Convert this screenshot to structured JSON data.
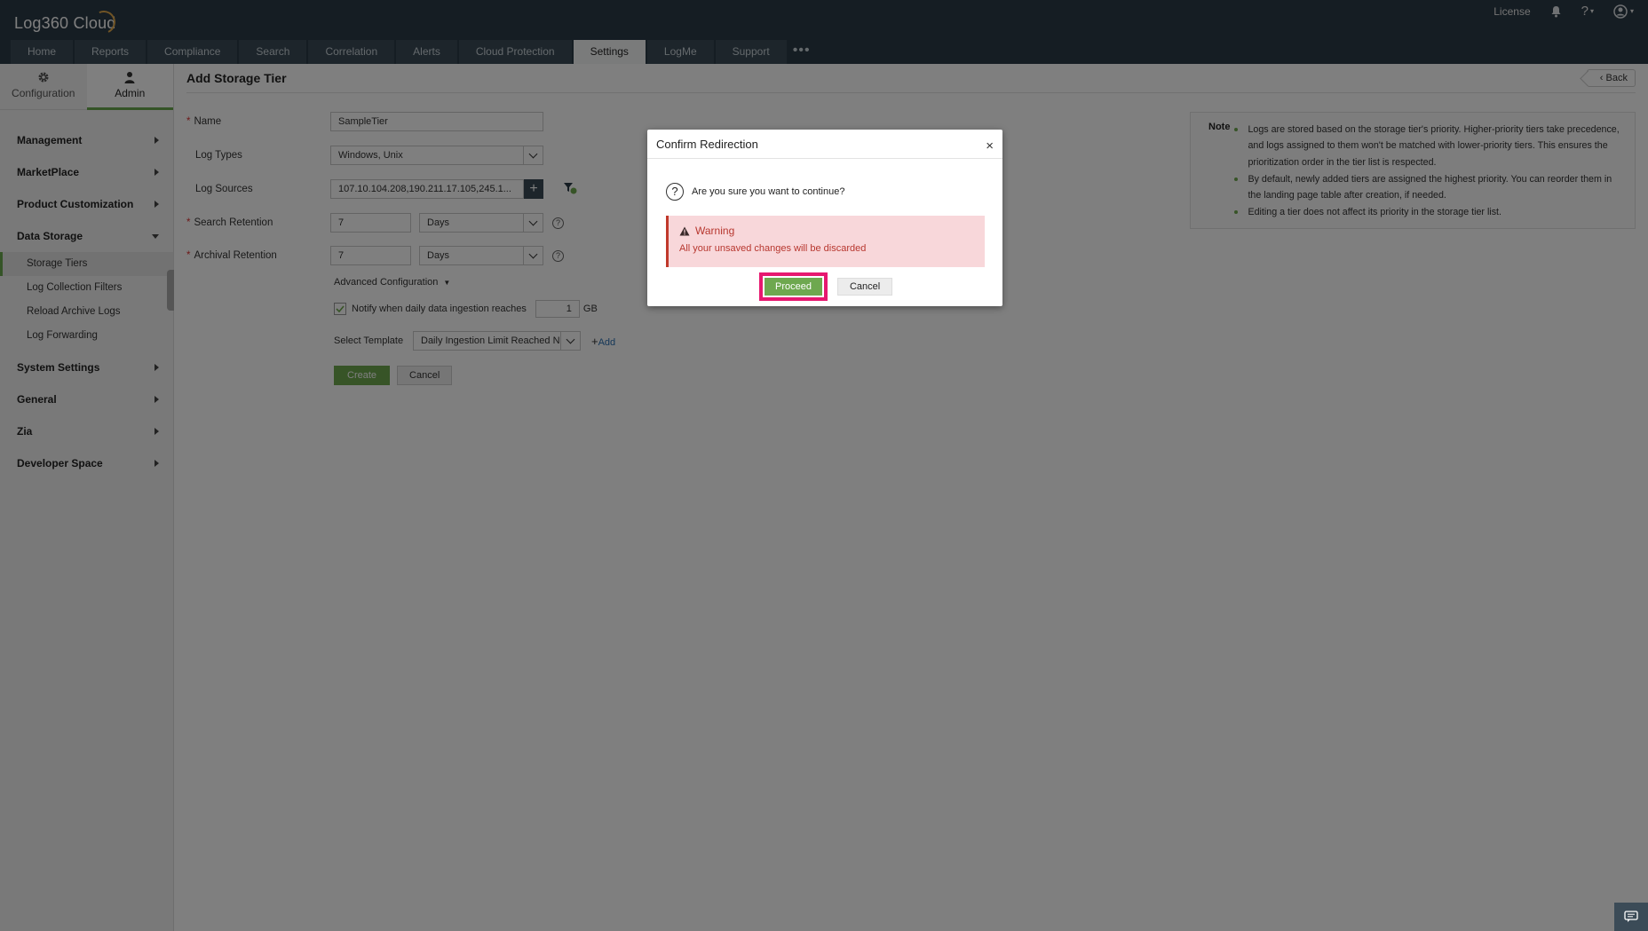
{
  "app": {
    "logo": "Log360 Cloud"
  },
  "header": {
    "license": "License",
    "tabs": [
      "Home",
      "Reports",
      "Compliance",
      "Search",
      "Correlation",
      "Alerts",
      "Cloud Protection",
      "Settings",
      "LogMe",
      "Support"
    ],
    "active_tab": "Settings",
    "more": "•••"
  },
  "sidebar": {
    "tabs": [
      {
        "label": "Configuration",
        "icon": "gear-icon"
      },
      {
        "label": "Admin",
        "icon": "user-icon"
      }
    ],
    "groups": [
      {
        "label": "Management"
      },
      {
        "label": "MarketPlace"
      },
      {
        "label": "Product Customization"
      },
      {
        "label": "Data Storage",
        "expanded": true,
        "items": [
          "Storage Tiers",
          "Log Collection Filters",
          "Reload Archive Logs",
          "Log Forwarding"
        ]
      },
      {
        "label": "System Settings"
      },
      {
        "label": "General"
      },
      {
        "label": "Zia"
      },
      {
        "label": "Developer Space"
      }
    ],
    "active_item": "Storage Tiers"
  },
  "main": {
    "title": "Add Storage Tier",
    "back": "Back",
    "form": {
      "name_label": "Name",
      "name_value": "SampleTier",
      "log_types_label": "Log Types",
      "log_types_value": "Windows, Unix",
      "log_sources_label": "Log Sources",
      "log_sources_value": "107.10.104.208,190.211.17.105,245.1...",
      "search_retention_label": "Search Retention",
      "search_retention_value": "7",
      "search_retention_unit": "Days",
      "archival_retention_label": "Archival Retention",
      "archival_retention_value": "7",
      "archival_retention_unit": "Days",
      "advanced": "Advanced Configuration",
      "notify_label": "Notify when daily data ingestion reaches",
      "notify_value": "1",
      "notify_unit": "GB",
      "notify_checked": true,
      "template_label": "Select Template",
      "template_value": "Daily Ingestion Limit Reached N",
      "add": "Add",
      "create": "Create",
      "cancel": "Cancel"
    },
    "note": {
      "title": "Note",
      "items": [
        "Logs are stored based on the storage tier's priority. Higher-priority tiers take precedence, and logs assigned to them won't be matched with lower-priority tiers. This ensures the prioritization order in the tier list is respected.",
        "By default, newly added tiers are assigned the highest priority. You can reorder them in the landing page table after creation, if needed.",
        "Editing a tier does not affect its priority in the storage tier list."
      ]
    }
  },
  "dialog": {
    "title": "Confirm Redirection",
    "close": "×",
    "question": "Are you sure you want to continue?",
    "warning_title": "Warning",
    "warning_text": "All your unsaved changes will be discarded",
    "proceed": "Proceed",
    "cancel": "Cancel"
  },
  "colors": {
    "accent_green": "#6ea84f",
    "header_bg": "#2b3a46",
    "highlight": "#e6186f",
    "warning_text": "#b7372f"
  }
}
